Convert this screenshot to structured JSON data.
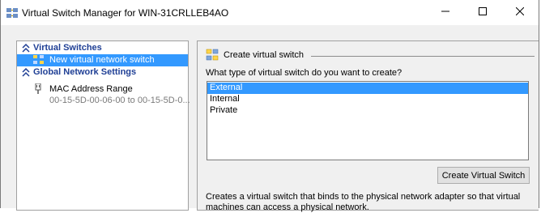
{
  "window": {
    "title": "Virtual Switch Manager for WIN-31CRLLEB4AO"
  },
  "sidebar": {
    "sections": [
      {
        "label": "Virtual Switches",
        "items": [
          {
            "label": "New virtual network switch",
            "selected": true,
            "icon": "network-switch-icon"
          }
        ]
      },
      {
        "label": "Global Network Settings",
        "items": [
          {
            "label": "MAC Address Range",
            "sublabel": "00-15-5D-00-06-00 to 00-15-5D-0...",
            "icon": "network-adapter-icon"
          }
        ]
      }
    ]
  },
  "main": {
    "header": "Create virtual switch",
    "question": "What type of virtual switch do you want to create?",
    "options": [
      {
        "label": "External",
        "selected": true
      },
      {
        "label": "Internal",
        "selected": false
      },
      {
        "label": "Private",
        "selected": false
      }
    ],
    "create_button_label": "Create Virtual Switch",
    "description": "Creates a virtual switch that binds to the physical network adapter so that virtual machines can access a physical network."
  },
  "colors": {
    "selection": "#3399ff",
    "section_header": "#1f3f95",
    "subtext": "#7a7a7a"
  }
}
